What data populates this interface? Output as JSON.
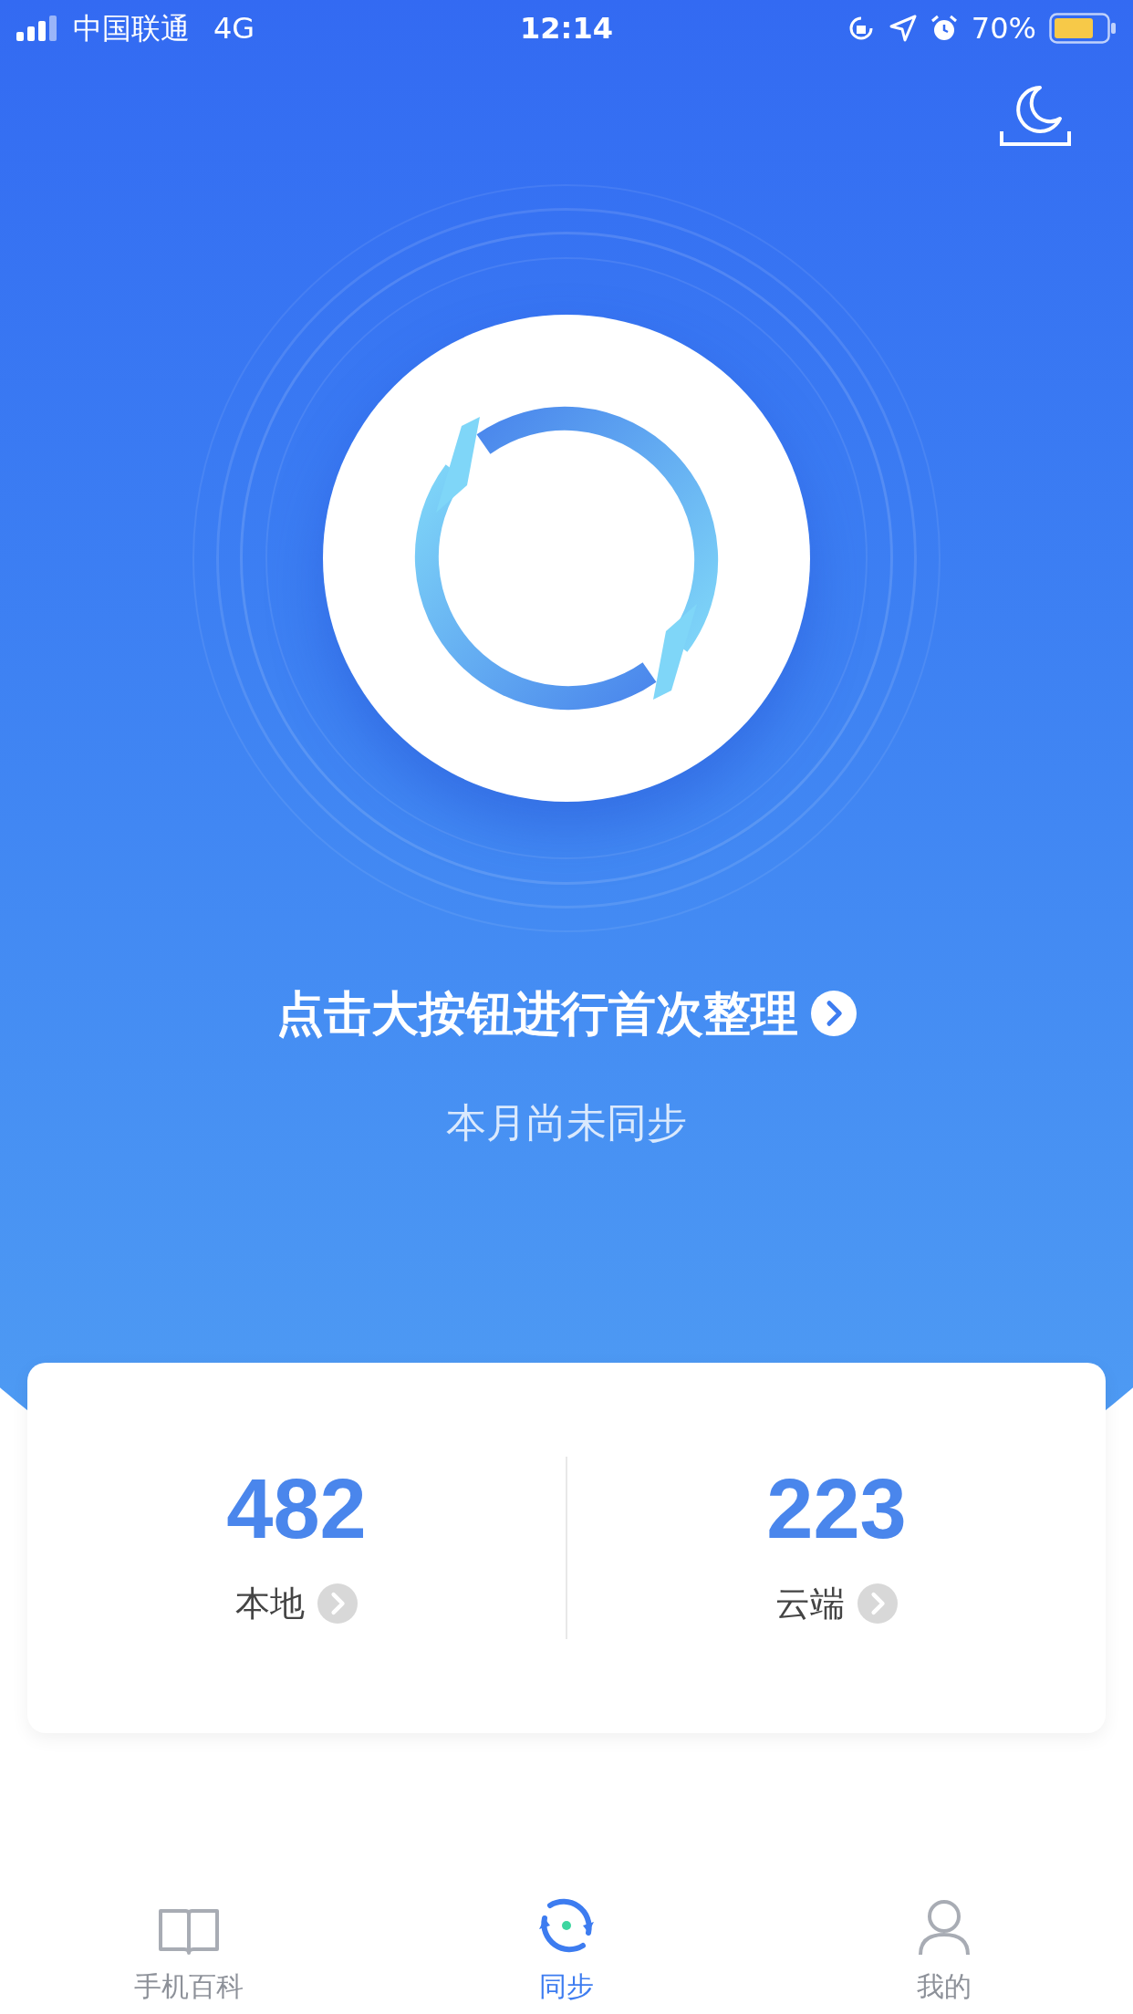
{
  "status_bar": {
    "carrier": "中国联通",
    "network": "4G",
    "time": "12:14",
    "battery": "70%"
  },
  "sync": {
    "headline": "点击大按钮进行首次整理",
    "subtitle": "本月尚未同步"
  },
  "stats": [
    {
      "value": "482",
      "label": "本地"
    },
    {
      "value": "223",
      "label": "云端"
    }
  ],
  "tabs": [
    {
      "label": "手机百科",
      "selected": false,
      "kind": "book"
    },
    {
      "label": "同步",
      "selected": true,
      "kind": "sync"
    },
    {
      "label": "我的",
      "selected": false,
      "kind": "person"
    }
  ]
}
